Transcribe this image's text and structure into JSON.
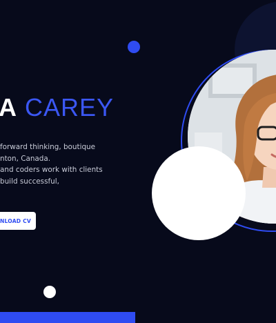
{
  "hero": {
    "name_first": "A",
    "name_last": "CAREY",
    "description": [
      "forward thinking, boutique",
      "nton, Canada.",
      "and coders work with clients",
      "build successful,"
    ],
    "download_button_label": "NLOAD CV",
    "photo_alt": "woman-with-glasses-photo"
  },
  "colors": {
    "background": "#070a1b",
    "accent": "#2f4cf2",
    "text_muted": "#c9ccd8",
    "white": "#ffffff"
  }
}
